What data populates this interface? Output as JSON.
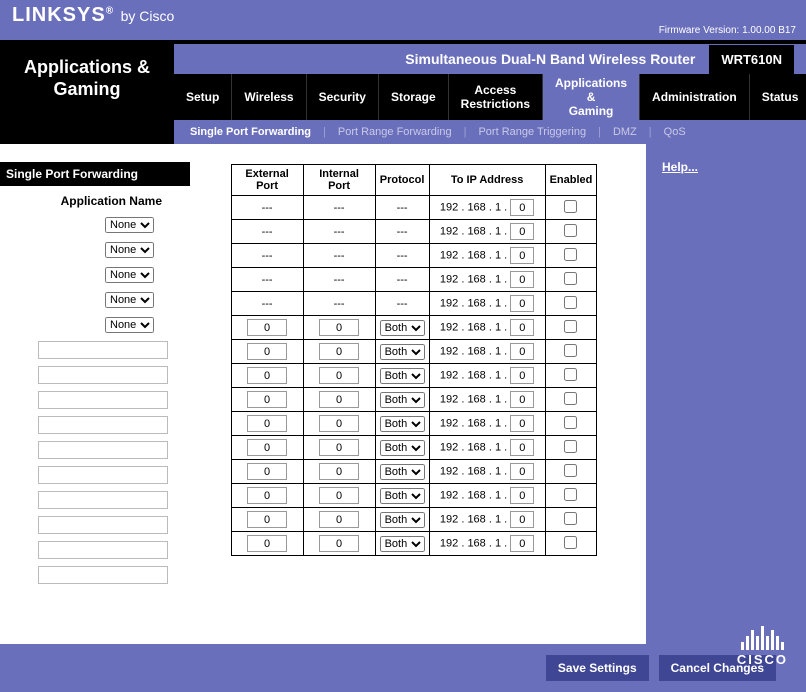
{
  "brand": {
    "name": "LINKSYS",
    "by": "by Cisco",
    "reg": "®"
  },
  "firmware": {
    "label": "Firmware Version:",
    "value": "1.00.00 B17"
  },
  "router": {
    "title": "Simultaneous Dual-N Band Wireless Router",
    "model": "WRT610N"
  },
  "section_title": "Applications & Gaming",
  "tabs": [
    {
      "label": "Setup"
    },
    {
      "label": "Wireless"
    },
    {
      "label": "Security"
    },
    {
      "label": "Storage"
    },
    {
      "label": "Access\nRestrictions"
    },
    {
      "label": "Applications &\nGaming",
      "active": true
    },
    {
      "label": "Administration"
    },
    {
      "label": "Status"
    }
  ],
  "subnav": [
    {
      "label": "Single Port Forwarding",
      "active": true
    },
    {
      "label": "Port Range Forwarding"
    },
    {
      "label": "Port Range Triggering"
    },
    {
      "label": "DMZ"
    },
    {
      "label": "QoS"
    }
  ],
  "left": {
    "subhead": "Single Port Forwarding",
    "app_col_label": "Application Name",
    "none_option": "None"
  },
  "table": {
    "headers": {
      "ext": "External Port",
      "int": "Internal Port",
      "prot": "Protocol",
      "ip": "To IP Address",
      "en": "Enabled"
    },
    "ip_prefix": "192 . 168 . 1 .",
    "placeholder": "---",
    "protocol_default": "Both",
    "preset_rows": 5,
    "custom_rows": 10,
    "default_port": "0",
    "default_octet": "0"
  },
  "help": {
    "label": "Help..."
  },
  "buttons": {
    "save": "Save Settings",
    "cancel": "Cancel Changes"
  },
  "cisco": {
    "label": "CISCO"
  }
}
